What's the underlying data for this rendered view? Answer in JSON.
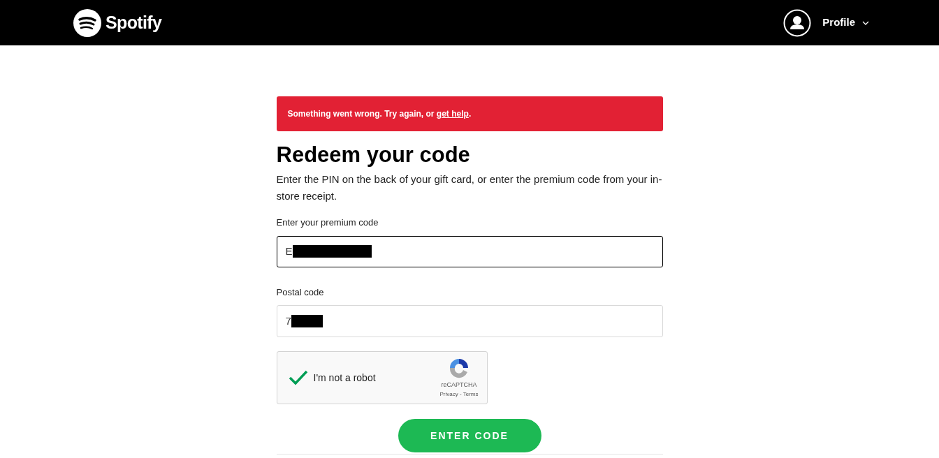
{
  "header": {
    "logo": "Spotify",
    "profile": "Profile"
  },
  "error": {
    "message": "Something went wrong. Try again, or ",
    "link": "get help",
    "end": "."
  },
  "title": "Redeem your code",
  "description": "Enter the PIN on the back of your gift card, or enter the premium code from your in-store receipt.",
  "fields": [
    {
      "label": "Enter your premium code",
      "value": "E",
      "focused": true
    },
    {
      "label": "Postal code",
      "value": "7",
      "focused": false
    }
  ],
  "captcha": {
    "label": "I'm not a robot",
    "checked": true,
    "brand": "reCAPTCHA",
    "privacy": "Privacy",
    "separator": " - ",
    "terms": "Terms"
  },
  "submit": "ENTER CODE"
}
